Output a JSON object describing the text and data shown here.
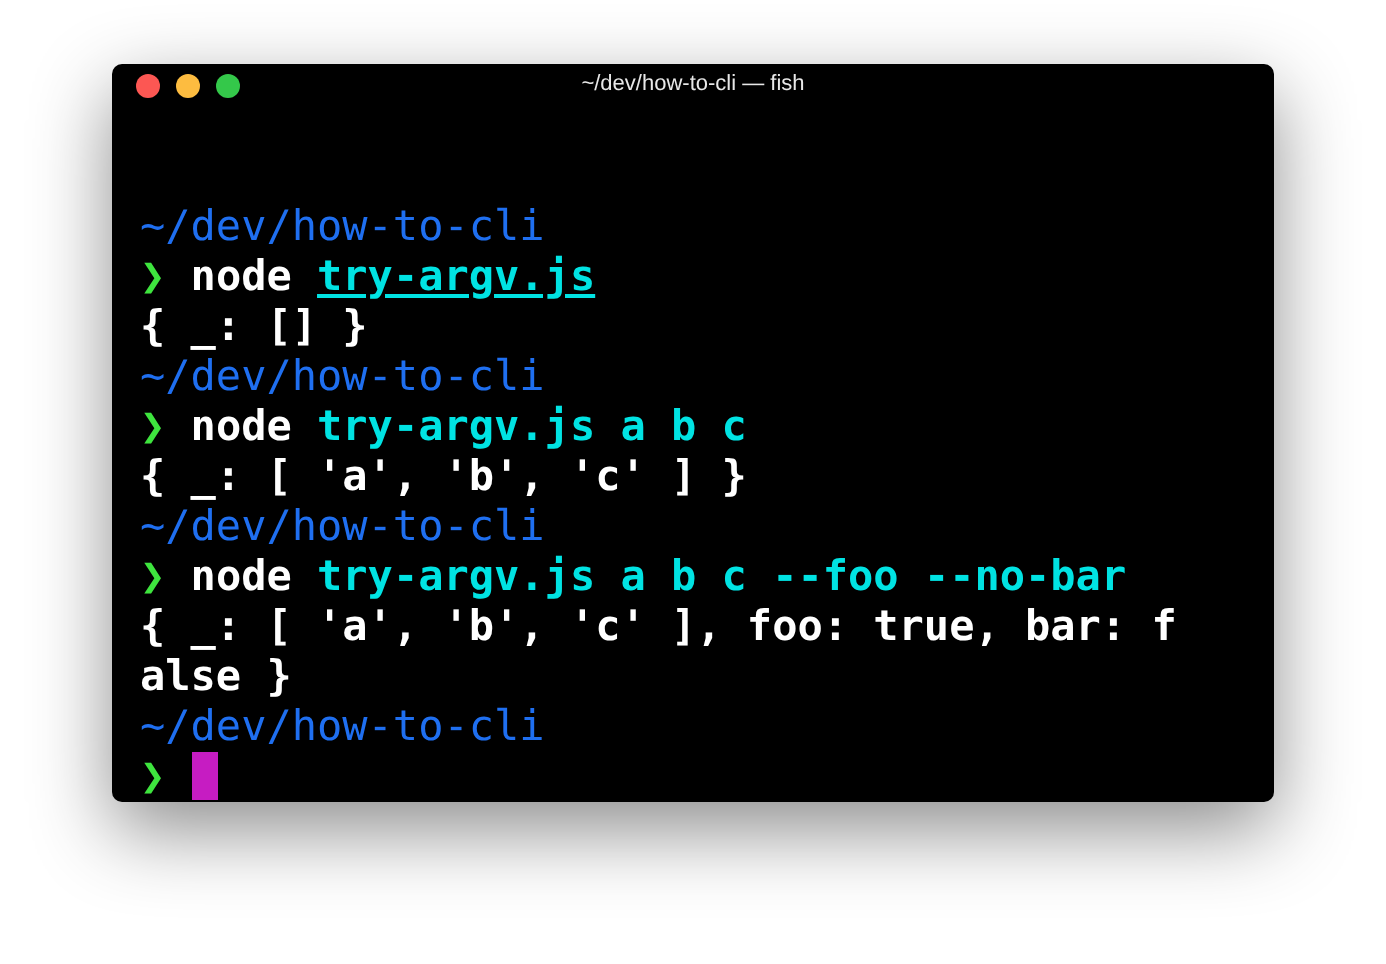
{
  "window": {
    "title": "~/dev/how-to-cli — fish"
  },
  "lines": [
    {
      "kind": "path",
      "text": "~/dev/how-to-cli"
    },
    {
      "kind": "command",
      "prompt": "❯",
      "program": "node",
      "args": "try-argv.js",
      "underlined": true
    },
    {
      "kind": "output",
      "text": "{ _: [] }"
    },
    {
      "kind": "path",
      "text": "~/dev/how-to-cli"
    },
    {
      "kind": "command",
      "prompt": "❯",
      "program": "node",
      "args": "try-argv.js a b c",
      "underlined": false
    },
    {
      "kind": "output",
      "text": "{ _: [ 'a', 'b', 'c' ] }"
    },
    {
      "kind": "path",
      "text": "~/dev/how-to-cli"
    },
    {
      "kind": "command",
      "prompt": "❯",
      "program": "node",
      "args": "try-argv.js a b c --foo --no-bar",
      "underlined": false
    },
    {
      "kind": "output",
      "text": "{ _: [ 'a', 'b', 'c' ], foo: true, bar: false }"
    },
    {
      "kind": "path",
      "text": "~/dev/how-to-cli"
    },
    {
      "kind": "input",
      "prompt": "❯"
    }
  ]
}
